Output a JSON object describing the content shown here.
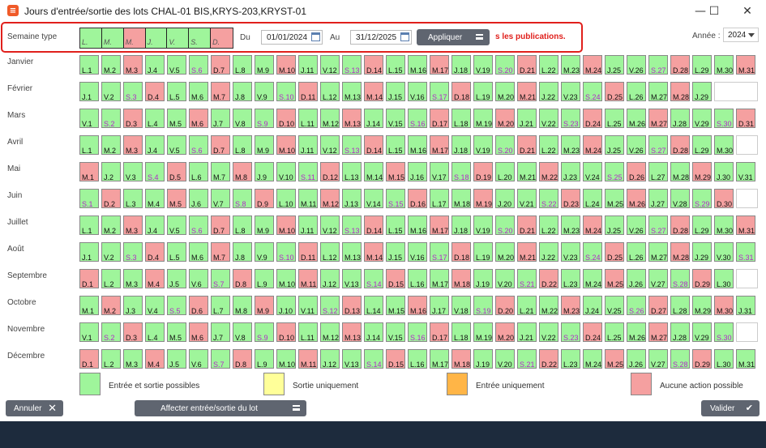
{
  "window": {
    "title": "Jours d'entrée/sortie des lots CHAL-01 BIS,KRYS-203,KRYST-01",
    "icon": "app-logo-icon",
    "minimize": "—",
    "maximize": "☐",
    "close": "✕"
  },
  "toolbar": {
    "semaine_label": "Semaine type",
    "semaine_days": [
      {
        "label": "L.",
        "color": "g"
      },
      {
        "label": "M.",
        "color": "g"
      },
      {
        "label": "M.",
        "color": "r"
      },
      {
        "label": "J.",
        "color": "g"
      },
      {
        "label": "V.",
        "color": "g"
      },
      {
        "label": "S.",
        "color": "g"
      },
      {
        "label": "D.",
        "color": "r"
      }
    ],
    "du_label": "Du",
    "du_value": "01/01/2024",
    "au_label": "Au",
    "au_value": "31/12/2025",
    "apply_label": "Appliquer",
    "publications_text": "s les publications.",
    "year_label": "Année :",
    "year_value": "2024"
  },
  "colors": {
    "green": "#9ff59b",
    "red": "#f5a0a0",
    "yellow": "#ffff99",
    "orange": "#ffb547",
    "weekend_text": "#b329c8",
    "highlight": "#e0201c"
  },
  "months": [
    {
      "name": "Janvier",
      "days": [
        "L.1",
        "M.2",
        "M.3",
        "J.4",
        "V.5",
        "S.6",
        "D.7",
        "L.8",
        "M.9",
        "M.10",
        "J.11",
        "V.12",
        "S.13",
        "D.14",
        "L.15",
        "M.16",
        "M.17",
        "J.18",
        "V.19",
        "S.20",
        "D.21",
        "L.22",
        "M.23",
        "M.24",
        "J.25",
        "V.26",
        "S.27",
        "D.28",
        "L.29",
        "M.30",
        "M.31"
      ]
    },
    {
      "name": "Février",
      "days": [
        "J.1",
        "V.2",
        "S.3",
        "D.4",
        "L.5",
        "M.6",
        "M.7",
        "J.8",
        "V.9",
        "S.10",
        "D.11",
        "L.12",
        "M.13",
        "M.14",
        "J.15",
        "V.16",
        "S.17",
        "D.18",
        "L.19",
        "M.20",
        "M.21",
        "J.22",
        "V.23",
        "S.24",
        "D.25",
        "L.26",
        "M.27",
        "M.28",
        "J.29"
      ]
    },
    {
      "name": "Mars",
      "days": [
        "V.1",
        "S.2",
        "D.3",
        "L.4",
        "M.5",
        "M.6",
        "J.7",
        "V.8",
        "S.9",
        "D.10",
        "L.11",
        "M.12",
        "M.13",
        "J.14",
        "V.15",
        "S.16",
        "D.17",
        "L.18",
        "M.19",
        "M.20",
        "J.21",
        "V.22",
        "S.23",
        "D.24",
        "L.25",
        "M.26",
        "M.27",
        "J.28",
        "V.29",
        "S.30",
        "D.31"
      ]
    },
    {
      "name": "Avril",
      "days": [
        "L.1",
        "M.2",
        "M.3",
        "J.4",
        "V.5",
        "S.6",
        "D.7",
        "L.8",
        "M.9",
        "M.10",
        "J.11",
        "V.12",
        "S.13",
        "D.14",
        "L.15",
        "M.16",
        "M.17",
        "J.18",
        "V.19",
        "S.20",
        "D.21",
        "L.22",
        "M.23",
        "M.24",
        "J.25",
        "V.26",
        "S.27",
        "D.28",
        "L.29",
        "M.30"
      ]
    },
    {
      "name": "Mai",
      "days": [
        "M.1",
        "J.2",
        "V.3",
        "S.4",
        "D.5",
        "L.6",
        "M.7",
        "M.8",
        "J.9",
        "V.10",
        "S.11",
        "D.12",
        "L.13",
        "M.14",
        "M.15",
        "J.16",
        "V.17",
        "S.18",
        "D.19",
        "L.20",
        "M.21",
        "M.22",
        "J.23",
        "V.24",
        "S.25",
        "D.26",
        "L.27",
        "M.28",
        "M.29",
        "J.30",
        "V.31"
      ]
    },
    {
      "name": "Juin",
      "days": [
        "S.1",
        "D.2",
        "L.3",
        "M.4",
        "M.5",
        "J.6",
        "V.7",
        "S.8",
        "D.9",
        "L.10",
        "M.11",
        "M.12",
        "J.13",
        "V.14",
        "S.15",
        "D.16",
        "L.17",
        "M.18",
        "M.19",
        "J.20",
        "V.21",
        "S.22",
        "D.23",
        "L.24",
        "M.25",
        "M.26",
        "J.27",
        "V.28",
        "S.29",
        "D.30"
      ]
    },
    {
      "name": "Juillet",
      "days": [
        "L.1",
        "M.2",
        "M.3",
        "J.4",
        "V.5",
        "S.6",
        "D.7",
        "L.8",
        "M.9",
        "M.10",
        "J.11",
        "V.12",
        "S.13",
        "D.14",
        "L.15",
        "M.16",
        "M.17",
        "J.18",
        "V.19",
        "S.20",
        "D.21",
        "L.22",
        "M.23",
        "M.24",
        "J.25",
        "V.26",
        "S.27",
        "D.28",
        "L.29",
        "M.30",
        "M.31"
      ]
    },
    {
      "name": "Août",
      "days": [
        "J.1",
        "V.2",
        "S.3",
        "D.4",
        "L.5",
        "M.6",
        "M.7",
        "J.8",
        "V.9",
        "S.10",
        "D.11",
        "L.12",
        "M.13",
        "M.14",
        "J.15",
        "V.16",
        "S.17",
        "D.18",
        "L.19",
        "M.20",
        "M.21",
        "J.22",
        "V.23",
        "S.24",
        "D.25",
        "L.26",
        "M.27",
        "M.28",
        "J.29",
        "V.30",
        "S.31"
      ]
    },
    {
      "name": "Septembre",
      "days": [
        "D.1",
        "L.2",
        "M.3",
        "M.4",
        "J.5",
        "V.6",
        "S.7",
        "D.8",
        "L.9",
        "M.10",
        "M.11",
        "J.12",
        "V.13",
        "S.14",
        "D.15",
        "L.16",
        "M.17",
        "M.18",
        "J.19",
        "V.20",
        "S.21",
        "D.22",
        "L.23",
        "M.24",
        "M.25",
        "J.26",
        "V.27",
        "S.28",
        "D.29",
        "L.30"
      ]
    },
    {
      "name": "Octobre",
      "days": [
        "M.1",
        "M.2",
        "J.3",
        "V.4",
        "S.5",
        "D.6",
        "L.7",
        "M.8",
        "M.9",
        "J.10",
        "V.11",
        "S.12",
        "D.13",
        "L.14",
        "M.15",
        "M.16",
        "J.17",
        "V.18",
        "S.19",
        "D.20",
        "L.21",
        "M.22",
        "M.23",
        "J.24",
        "V.25",
        "S.26",
        "D.27",
        "L.28",
        "M.29",
        "M.30",
        "J.31"
      ]
    },
    {
      "name": "Novembre",
      "days": [
        "V.1",
        "S.2",
        "D.3",
        "L.4",
        "M.5",
        "M.6",
        "J.7",
        "V.8",
        "S.9",
        "D.10",
        "L.11",
        "M.12",
        "M.13",
        "J.14",
        "V.15",
        "S.16",
        "D.17",
        "L.18",
        "M.19",
        "M.20",
        "J.21",
        "V.22",
        "S.23",
        "D.24",
        "L.25",
        "M.26",
        "M.27",
        "J.28",
        "V.29",
        "S.30"
      ]
    },
    {
      "name": "Décembre",
      "days": [
        "D.1",
        "L.2",
        "M.3",
        "M.4",
        "J.5",
        "V.6",
        "S.7",
        "D.8",
        "L.9",
        "M.10",
        "M.11",
        "J.12",
        "V.13",
        "S.14",
        "D.15",
        "L.16",
        "M.17",
        "M.18",
        "J.19",
        "V.20",
        "S.21",
        "D.22",
        "L.23",
        "M.24",
        "M.25",
        "J.26",
        "V.27",
        "S.28",
        "D.29",
        "L.30",
        "M.31"
      ]
    }
  ],
  "legend": [
    {
      "label": "Entrée et sortie possibles",
      "color": "#9ff59b"
    },
    {
      "label": "Sortie uniquement",
      "color": "#ffff99"
    },
    {
      "label": "Entrée uniquement",
      "color": "#ffb547"
    },
    {
      "label": "Aucune action possible",
      "color": "#f5a0a0"
    }
  ],
  "footer": {
    "annuler_label": "Annuler",
    "affecter_label": "Affecter entrée/sortie du lot",
    "valider_label": "Valider"
  }
}
